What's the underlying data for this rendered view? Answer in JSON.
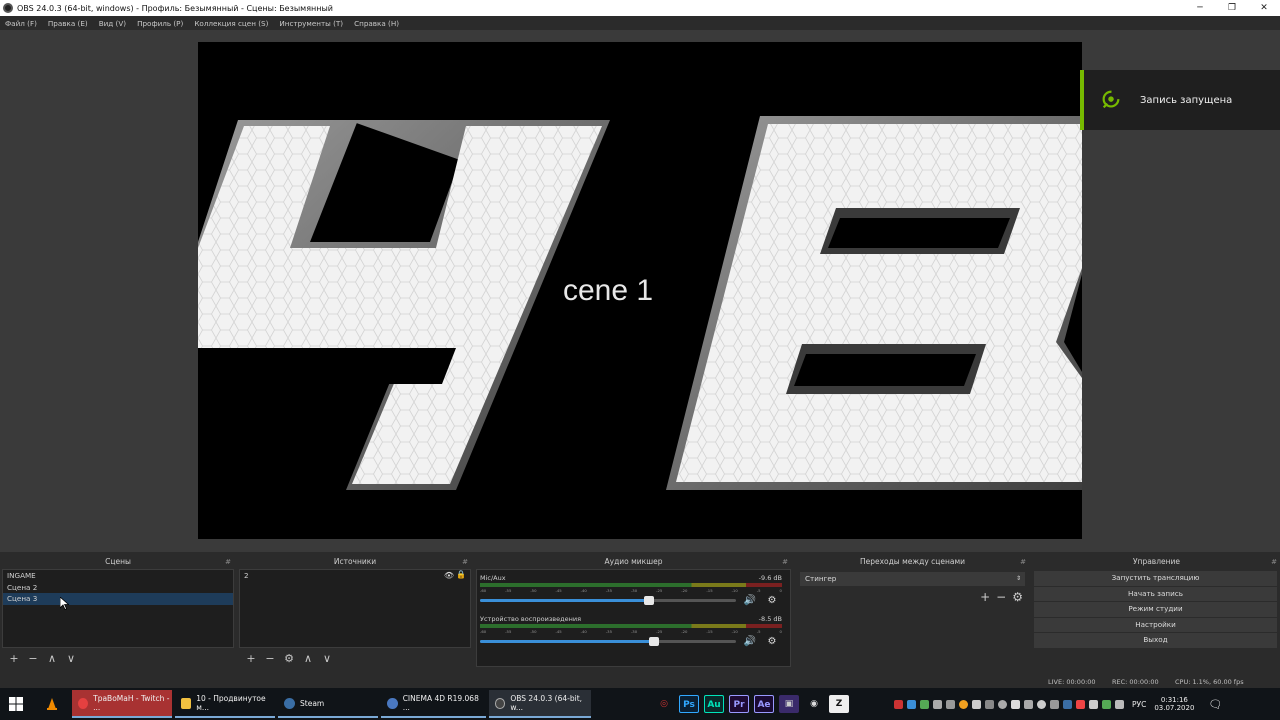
{
  "window": {
    "title": "OBS 24.0.3 (64-bit, windows) - Профиль: Безымянный - Сцены: Безымянный",
    "controls": [
      "─",
      "❐",
      "✕"
    ]
  },
  "menu": [
    "Файл (F)",
    "Правка (E)",
    "Вид (V)",
    "Профиль (P)",
    "Коллекция сцен (S)",
    "Инструменты (T)",
    "Справка (H)"
  ],
  "preview": {
    "overlay_text": "cene 1"
  },
  "toast": {
    "text": "Запись запущена",
    "accent": "#76b900"
  },
  "scenes": {
    "title": "Сцены",
    "items": [
      "INGAME",
      "Сцена 2",
      "Сцена 3"
    ],
    "selected_index": 2,
    "toolbar": [
      "+",
      "−",
      "∧",
      "∨"
    ]
  },
  "sources": {
    "title": "Источники",
    "items": [
      "2"
    ],
    "toolbar": [
      "+",
      "−",
      "⚙",
      "∧",
      "∨"
    ]
  },
  "mixer": {
    "title": "Аудио микшер",
    "channels": [
      {
        "name": "Mic/Aux",
        "db": "-9.6 dB",
        "volume": 0.66
      },
      {
        "name": "Устройство воспроизведения",
        "db": "-8.5 dB",
        "volume": 0.68
      }
    ],
    "scale": [
      "-60",
      "-55",
      "-50",
      "-45",
      "-40",
      "-35",
      "-30",
      "-25",
      "-20",
      "-15",
      "-10",
      "-5",
      "0"
    ]
  },
  "transitions": {
    "title": "Переходы между сценами",
    "selected": "Стингер",
    "toolbar": [
      "+",
      "−",
      "⚙"
    ]
  },
  "controls": {
    "title": "Управление",
    "buttons": [
      "Запустить трансляцию",
      "Начать запись",
      "Режим студии",
      "Настройки",
      "Выход"
    ]
  },
  "status": {
    "live": "LIVE: 00:00:00",
    "rec": "REC: 00:00:00",
    "cpu": "CPU: 1.1%, 60.00 fps"
  },
  "taskbar": {
    "items": [
      {
        "label": "ТраВоМаН - Twitch - ...",
        "color": "#c0392b"
      },
      {
        "label": "10 - Продвинутое м...",
        "color": "#f0c040"
      },
      {
        "label": "Steam",
        "color": "#3a6ea5"
      },
      {
        "label": "CINEMA 4D R19.068 ...",
        "color": "#4a78c0"
      },
      {
        "label": "OBS 24.0.3 (64-bit, w...",
        "color": "#444444"
      }
    ],
    "apps": [
      {
        "label": "Ps",
        "bg": "#0a1f33",
        "fg": "#31a8ff"
      },
      {
        "label": "Au",
        "bg": "#0a2a2a",
        "fg": "#00e4bb"
      },
      {
        "label": "Pr",
        "bg": "#1e0a33",
        "fg": "#9999ff"
      },
      {
        "label": "Ae",
        "bg": "#1a0a33",
        "fg": "#9999ff"
      }
    ],
    "lang": "РУС",
    "time": "0:31:16",
    "date": "03.07.2020"
  }
}
